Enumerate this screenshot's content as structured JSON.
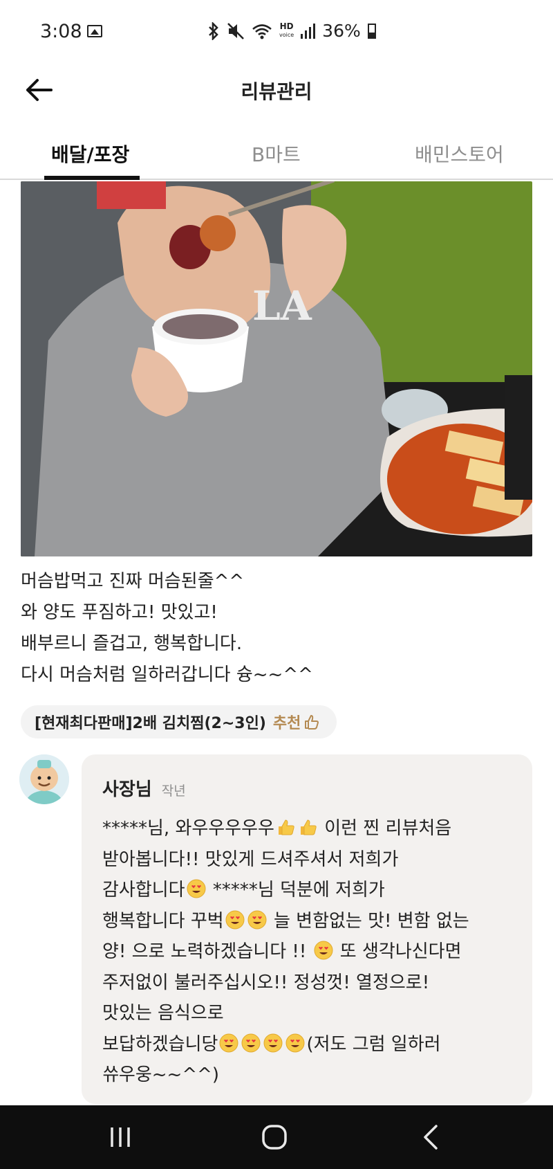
{
  "status_bar": {
    "time": "3:08",
    "hd_label": "HD",
    "hd_sub": "voice",
    "battery": "36%"
  },
  "icons": {
    "back": "arrow-left-icon",
    "gallery": "image-icon",
    "bluetooth": "bluetooth-icon",
    "mute": "vibrate-mute-icon",
    "wifi": "wifi-icon",
    "signal": "signal-icon",
    "battery": "battery-icon",
    "thumbs": "thumbs-up-icon"
  },
  "header": {
    "title": "리뷰관리"
  },
  "tabs": [
    {
      "label": "배달/포장",
      "active": true
    },
    {
      "label": "B마트",
      "active": false
    },
    {
      "label": "배민스토어",
      "active": false
    }
  ],
  "review": {
    "lines": [
      "머슴밥먹고 진짜 머슴된줄^^",
      "와 양도 푸짐하고! 맛있고!",
      "배부르니 즐겁고, 행복합니다.",
      "다시 머슴처럼 일하러갑니다 슝~~^^"
    ],
    "menu_item": "[현재최다판매]2배 김치찜(2~3인)",
    "recommend": "추천"
  },
  "reply": {
    "author": "사장님",
    "time": "작년",
    "lines": [
      [
        "*****님, 와우우우우우",
        "👍",
        "👍",
        " 이런 찐 리뷰처음"
      ],
      [
        "받아봅니다!! 맛있게 드셔주셔서 저희가"
      ],
      [
        "감사합니다",
        "😍",
        " *****님 덕분에 저희가"
      ],
      [
        "행복합니다 꾸벅",
        "😍",
        "😍",
        " 늘 변함없는 맛! 변함 없는"
      ],
      [
        "양! 으로 노력하겠습니다 !! ",
        "😍",
        " 또 생각나신다면"
      ],
      [
        "주저없이 불러주십시오!! 정성껏! 열정으로!"
      ],
      [
        "맛있는 음식으로"
      ],
      [
        "보답하겠습니당",
        "😍",
        "😍",
        "😍",
        "😍",
        "(저도 그럼 일하러"
      ],
      [
        "쓔우웅~~^^)"
      ]
    ]
  },
  "colors": {
    "accent_brown": "#b48a52",
    "nav_bg": "#0e0e0e",
    "reply_bg": "#f3f1ef",
    "chip_bg": "#f3f3f3"
  }
}
